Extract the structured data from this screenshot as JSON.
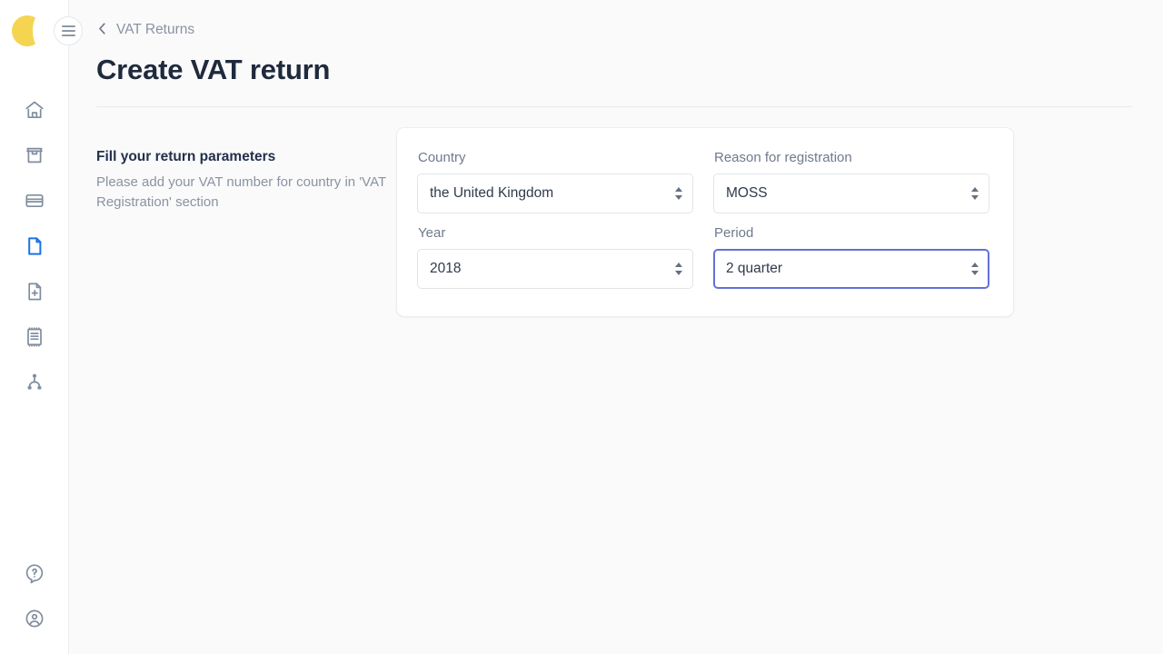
{
  "sidebar": {
    "logo": {
      "icon": "app-logo-circle",
      "color": "#f5d450"
    },
    "menu_toggle": {
      "icon": "hamburger-icon",
      "label": "Menu"
    },
    "top_items": [
      {
        "icon": "home-icon",
        "label": "Home",
        "active": false
      },
      {
        "icon": "store-icon",
        "label": "Store",
        "active": false
      },
      {
        "icon": "card-icon",
        "label": "Payments",
        "active": false
      },
      {
        "icon": "document-icon",
        "label": "VAT Returns",
        "active": true
      },
      {
        "icon": "document-add-icon",
        "label": "New document",
        "active": false
      },
      {
        "icon": "receipt-icon",
        "label": "Invoices",
        "active": false
      },
      {
        "icon": "hierarchy-icon",
        "label": "Organisation",
        "active": false
      }
    ],
    "bottom_items": [
      {
        "icon": "help-icon",
        "label": "Help",
        "active": false
      },
      {
        "icon": "account-icon",
        "label": "Account",
        "active": false
      }
    ],
    "active_accent": "#1a73e8",
    "idle_color": "#808d9e"
  },
  "header": {
    "breadcrumb": {
      "back_icon": "chevron-left-icon",
      "label": "VAT Returns"
    },
    "title": "Create VAT return"
  },
  "intro": {
    "title": "Fill your return parameters",
    "subtitle": "Please add your VAT number for country in 'VAT Registration' section"
  },
  "form": {
    "fields": [
      {
        "name": "country",
        "label": "Country",
        "value": "the United Kingdom",
        "icon": "select-stepper-icon",
        "focused": false
      },
      {
        "name": "reason",
        "label": "Reason for registration",
        "value": "MOSS",
        "icon": "select-stepper-icon",
        "focused": false
      },
      {
        "name": "year",
        "label": "Year",
        "value": "2018",
        "icon": "select-stepper-icon",
        "focused": false
      },
      {
        "name": "period",
        "label": "Period",
        "value": "2 quarter",
        "icon": "select-stepper-icon",
        "focused": true
      }
    ],
    "focus_color": "#6470d8",
    "border_color": "#e2e4e9"
  }
}
